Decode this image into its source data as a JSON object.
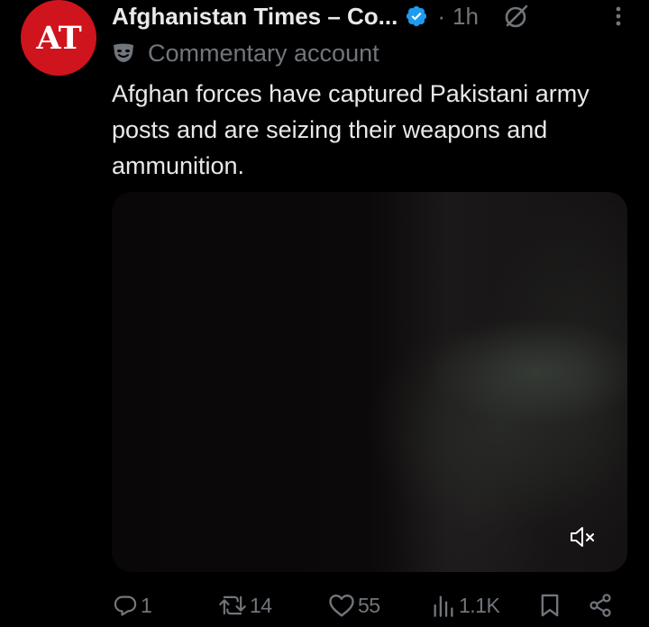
{
  "post": {
    "avatar_text": "AT",
    "author_name": "Afghanistan Times – Co...",
    "time_separator": "·",
    "time": "1h",
    "label": "Commentary account",
    "text": "Afghan forces have captured Pakistani army posts and are seizing their weapons and ammunition."
  },
  "media": {
    "type": "video",
    "muted_icon": "volume-muted-icon"
  },
  "actions": {
    "replies": "1",
    "reposts": "14",
    "likes": "55",
    "views": "1.1K"
  },
  "colors": {
    "background": "#000000",
    "text_primary": "#e7e9ea",
    "text_secondary": "#71767b",
    "verified": "#1d9bf0",
    "avatar_bg": "#d0141d"
  }
}
